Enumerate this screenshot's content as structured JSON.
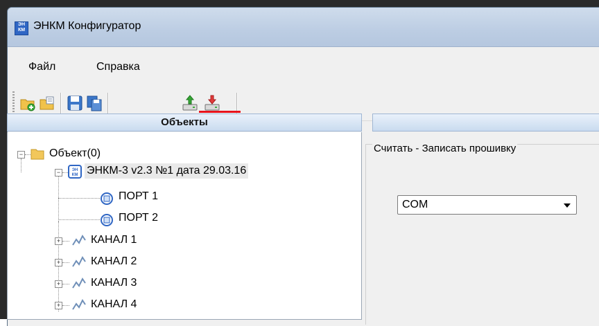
{
  "window": {
    "title": "ЭНКМ Конфигуратор",
    "icon": "app-icon",
    "icon_text": "ЭН КМ"
  },
  "menu": {
    "items": [
      "Файл",
      "Справка"
    ]
  },
  "toolbar": {
    "buttons": [
      "new-object-icon",
      "open-icon",
      "save-icon",
      "copy-icon",
      "upload-icon",
      "download-icon"
    ]
  },
  "left_panel": {
    "header": "Объекты"
  },
  "tree": {
    "root": "Объект(0)",
    "device": "ЭНКМ-3 v2.3 №1 дата 29.03.16",
    "ports": [
      "ПОРТ 1",
      "ПОРТ 2"
    ],
    "channels": [
      "КАНАЛ 1",
      "КАНАЛ 2",
      "КАНАЛ 3",
      "КАНАЛ 4"
    ]
  },
  "right_panel": {
    "group_title": "Считать - Записать прошивку",
    "port_select": "COM"
  },
  "colors": {
    "accent_underline": "#e8141c",
    "titlebar": "#bccde3"
  }
}
